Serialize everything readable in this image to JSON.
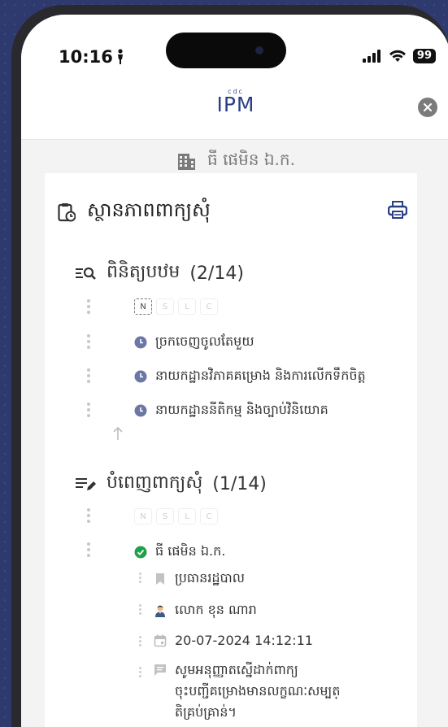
{
  "status_bar": {
    "time": "10:16",
    "battery": "99"
  },
  "header": {
    "logo_small": "cdc",
    "logo_text": "IPM"
  },
  "company": {
    "name": "ធី ផេមិន ឯ.ក."
  },
  "card": {
    "title": "ស្ថានភាពពាក្យសុំ",
    "sections": [
      {
        "title": "ពិនិត្យបឋម",
        "progress": "(2/14)",
        "chips": [
          "N",
          "S",
          "L",
          "C"
        ],
        "active_chip": "N",
        "items": [
          "ច្រកចេញចូលតែមួយ",
          "នាយកដ្ឋានវិភាគគម្រោង និងការលើកទឹកចិត្ត",
          "នាយកដ្ឋាននីតិកម្ម និងច្បាប់វិនិយោគ"
        ]
      },
      {
        "title": "បំពេញពាក្យសុំ",
        "progress": "(1/14)",
        "chips": [
          "N",
          "S",
          "L",
          "C"
        ],
        "entry": {
          "company": "ធី ផេមិន ឯ.ក.",
          "role": "ប្រធានរដ្ឋបាល",
          "person": "លោក ខុន ណារា",
          "datetime": "20-07-2024 14:12:11",
          "message_line1": "សូមអនុញ្ញាតស្នើដាក់ពាក្យ",
          "message_line2": "ចុះបញ្ជីគម្រោងមានលក្ខណៈសម្បត្",
          "message_line3": "តិគ្រប់គ្រាន់។"
        }
      }
    ]
  },
  "colors": {
    "accent": "#2a3f86",
    "clock": "#6b78a6",
    "success": "#1fa04a",
    "background": "#2e3a6e"
  }
}
